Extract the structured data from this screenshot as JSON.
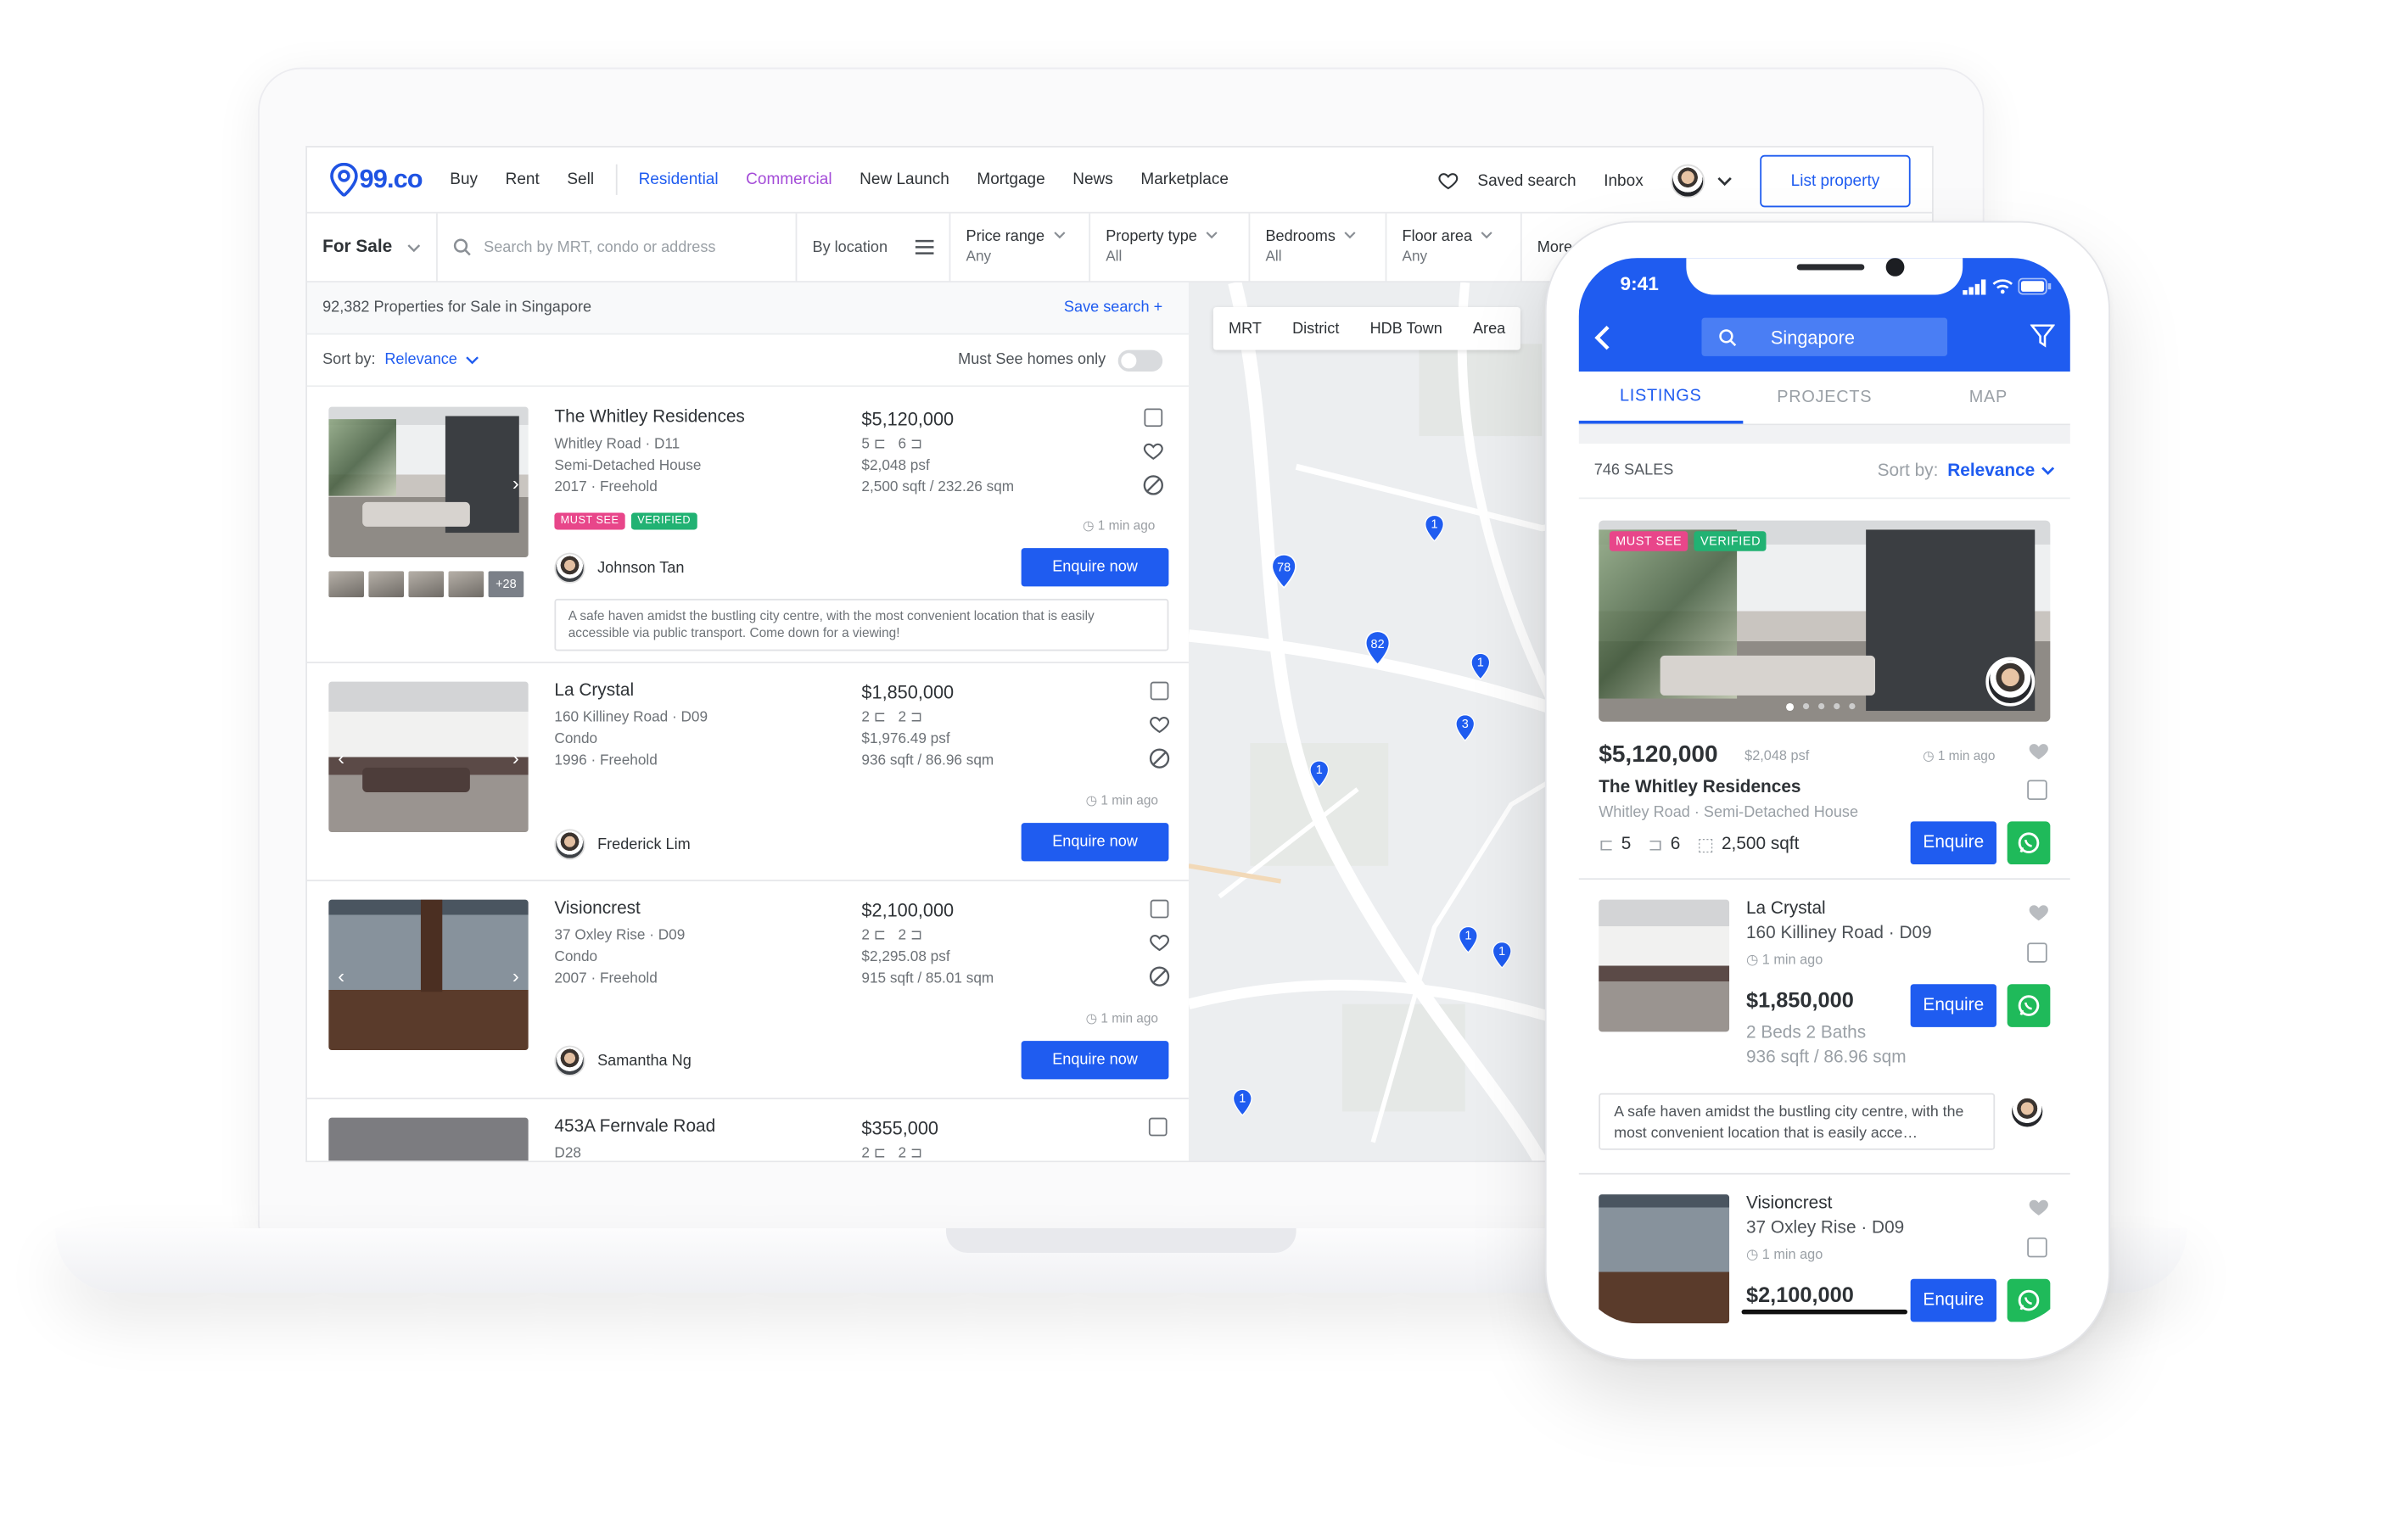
{
  "brand": {
    "logo_text": "99.co",
    "accent": "#1f5cf0",
    "commercial_color": "#a44cd8",
    "whatsapp": "#1fba5a",
    "must_see": "#e8468a",
    "verified": "#21b273"
  },
  "nav": {
    "items": [
      "Buy",
      "Rent",
      "Sell"
    ],
    "residential": "Residential",
    "commercial": "Commercial",
    "more_items": [
      "New Launch",
      "Mortgage",
      "News",
      "Marketplace"
    ],
    "saved_search": "Saved search",
    "inbox": "Inbox",
    "list_property": "List property"
  },
  "filters": {
    "mode": "For Sale",
    "search_placeholder": "Search by MRT, condo or address",
    "by_location": "By location",
    "price": {
      "title": "Price range",
      "value": "Any"
    },
    "ptype": {
      "title": "Property type",
      "value": "All"
    },
    "beds": {
      "title": "Bedrooms",
      "value": "All"
    },
    "floor": {
      "title": "Floor area",
      "value": "Any"
    },
    "more": "More"
  },
  "results": {
    "count_text": "92,382 Properties for Sale in Singapore",
    "save_search": "Save search +",
    "sort_label": "Sort by:",
    "sort_value": "Relevance",
    "must_see_label": "Must See homes only"
  },
  "listings": [
    {
      "title": "The Whitley Residences",
      "address": "Whitley Road · D11",
      "type": "Semi-Detached House",
      "year": "2017 · Freehold",
      "price": "$5,120,000",
      "beds": "5",
      "baths": "6",
      "psf": "$2,048 psf",
      "size": "2,500 sqft / 232.26 sqm",
      "agent": "Johnson Tan",
      "ago": "1 min ago",
      "enquire": "Enquire now",
      "badge_must": "MUST SEE",
      "badge_verified": "VERIFIED",
      "more_photos": "+28",
      "description": "A safe haven amidst the bustling city centre, with the most convenient location that is easily accessible via public transport. Come down for a viewing!"
    },
    {
      "title": "La Crystal",
      "address": "160 Killiney Road · D09",
      "type": "Condo",
      "year": "1996 · Freehold",
      "price": "$1,850,000",
      "beds": "2",
      "baths": "2",
      "psf": "$1,976.49 psf",
      "size": "936 sqft / 86.96 sqm",
      "agent": "Frederick Lim",
      "ago": "1 min ago",
      "enquire": "Enquire now"
    },
    {
      "title": "Visioncrest",
      "address": "37 Oxley Rise · D09",
      "type": "Condo",
      "year": "2007 · Freehold",
      "price": "$2,100,000",
      "beds": "2",
      "baths": "2",
      "psf": "$2,295.08 psf",
      "size": "915 sqft / 85.01 sqm",
      "agent": "Samantha Ng",
      "ago": "1 min ago",
      "enquire": "Enquire now"
    },
    {
      "title": "453A Fernvale Road",
      "address": "D28",
      "price": "$355,000",
      "beds": "2",
      "baths": "2"
    }
  ],
  "map": {
    "tabs": [
      "MRT",
      "District",
      "HDB Town",
      "Area"
    ],
    "pins": [
      "1",
      "78",
      "82",
      "1",
      "3",
      "1",
      "1",
      "1",
      "1"
    ]
  },
  "phone": {
    "time": "9:41",
    "search": "Singapore",
    "tabs": [
      "LISTINGS",
      "PROJECTS",
      "MAP"
    ],
    "sales_count": "746 SALES",
    "sort_label": "Sort by:",
    "sort_value": "Relevance",
    "hero": {
      "price": "$5,120,000",
      "psf": "$2,048 psf",
      "ago": "1 min ago",
      "title": "The Whitley Residences",
      "sub": "Whitley Road · Semi-Detached House",
      "beds": "5",
      "baths": "6",
      "size": "2,500 sqft",
      "badge_must": "MUST SEE",
      "badge_verified": "VERIFIED",
      "enquire": "Enquire"
    },
    "item2": {
      "title": "La Crystal",
      "address": "160 Killiney Road · D09",
      "ago": "1 min ago",
      "price": "$1,850,000",
      "rooms": "2 Beds   2 Baths",
      "size": "936 sqft / 86.96 sqm",
      "enquire": "Enquire",
      "note": "A safe haven amidst the bustling city centre, with the most convenient location that is easily acce…"
    },
    "item3": {
      "title": "Visioncrest",
      "address": "37 Oxley Rise · D09",
      "ago": "1 min ago",
      "price": "$2,100,000",
      "enquire": "Enquire"
    }
  }
}
